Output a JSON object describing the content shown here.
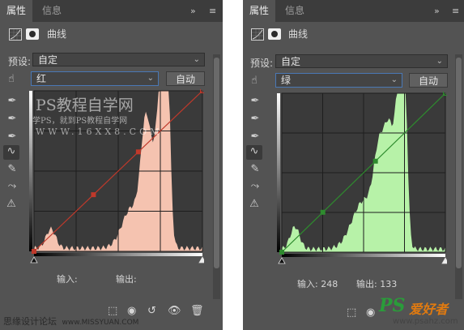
{
  "tabs": {
    "properties": "属性",
    "info": "信息",
    "collapse_glyph": "»",
    "menu_glyph": "≡"
  },
  "adjustment_title": "曲线",
  "preset": {
    "label": "预设:",
    "value": "自定"
  },
  "auto_label": "自动",
  "left_panel": {
    "channel": "红",
    "accent_color": "#c0392b",
    "histogram_color": "#f5c3b0",
    "input_label": "输入:",
    "output_label": "输出:",
    "watermark_title": "PS教程自学网",
    "watermark_line2": "学PS，就到PS教程自学网",
    "watermark_url": "WWW.16XX8.COM",
    "control_points": [
      {
        "in": 0,
        "out": 0
      },
      {
        "in": 90,
        "out": 90
      },
      {
        "in": 158,
        "out": 158
      },
      {
        "in": 255,
        "out": 255
      }
    ]
  },
  "right_panel": {
    "channel": "绿",
    "accent_color": "#2e8b2e",
    "histogram_color": "#b7f2a8",
    "input_label": "输入:",
    "input_value": "248",
    "output_label": "输出:",
    "output_value": "133",
    "control_points": [
      {
        "in": 0,
        "out": 0
      },
      {
        "in": 64,
        "out": 64
      },
      {
        "in": 146,
        "out": 146
      },
      {
        "in": 255,
        "out": 255
      }
    ]
  },
  "footer": {
    "left_text": "思缘设计论坛",
    "left_url": "www.MISSYUAN.COM",
    "logo_ps": "PS",
    "logo_cn": "爱好者",
    "logo_url": "www.psahz.com"
  },
  "icons": [
    "curves-adjustment-icon",
    "layer-mask-icon",
    "targeted-adjustment-icon",
    "black-point-eyedropper-icon",
    "gray-point-eyedropper-icon",
    "white-point-eyedropper-icon",
    "curve-edit-points-icon",
    "pencil-draw-icon",
    "smooth-curve-icon",
    "clipping-warning-icon",
    "clip-to-layer-icon",
    "view-previous-state-icon",
    "reset-icon",
    "visibility-eye-icon",
    "delete-trash-icon"
  ]
}
